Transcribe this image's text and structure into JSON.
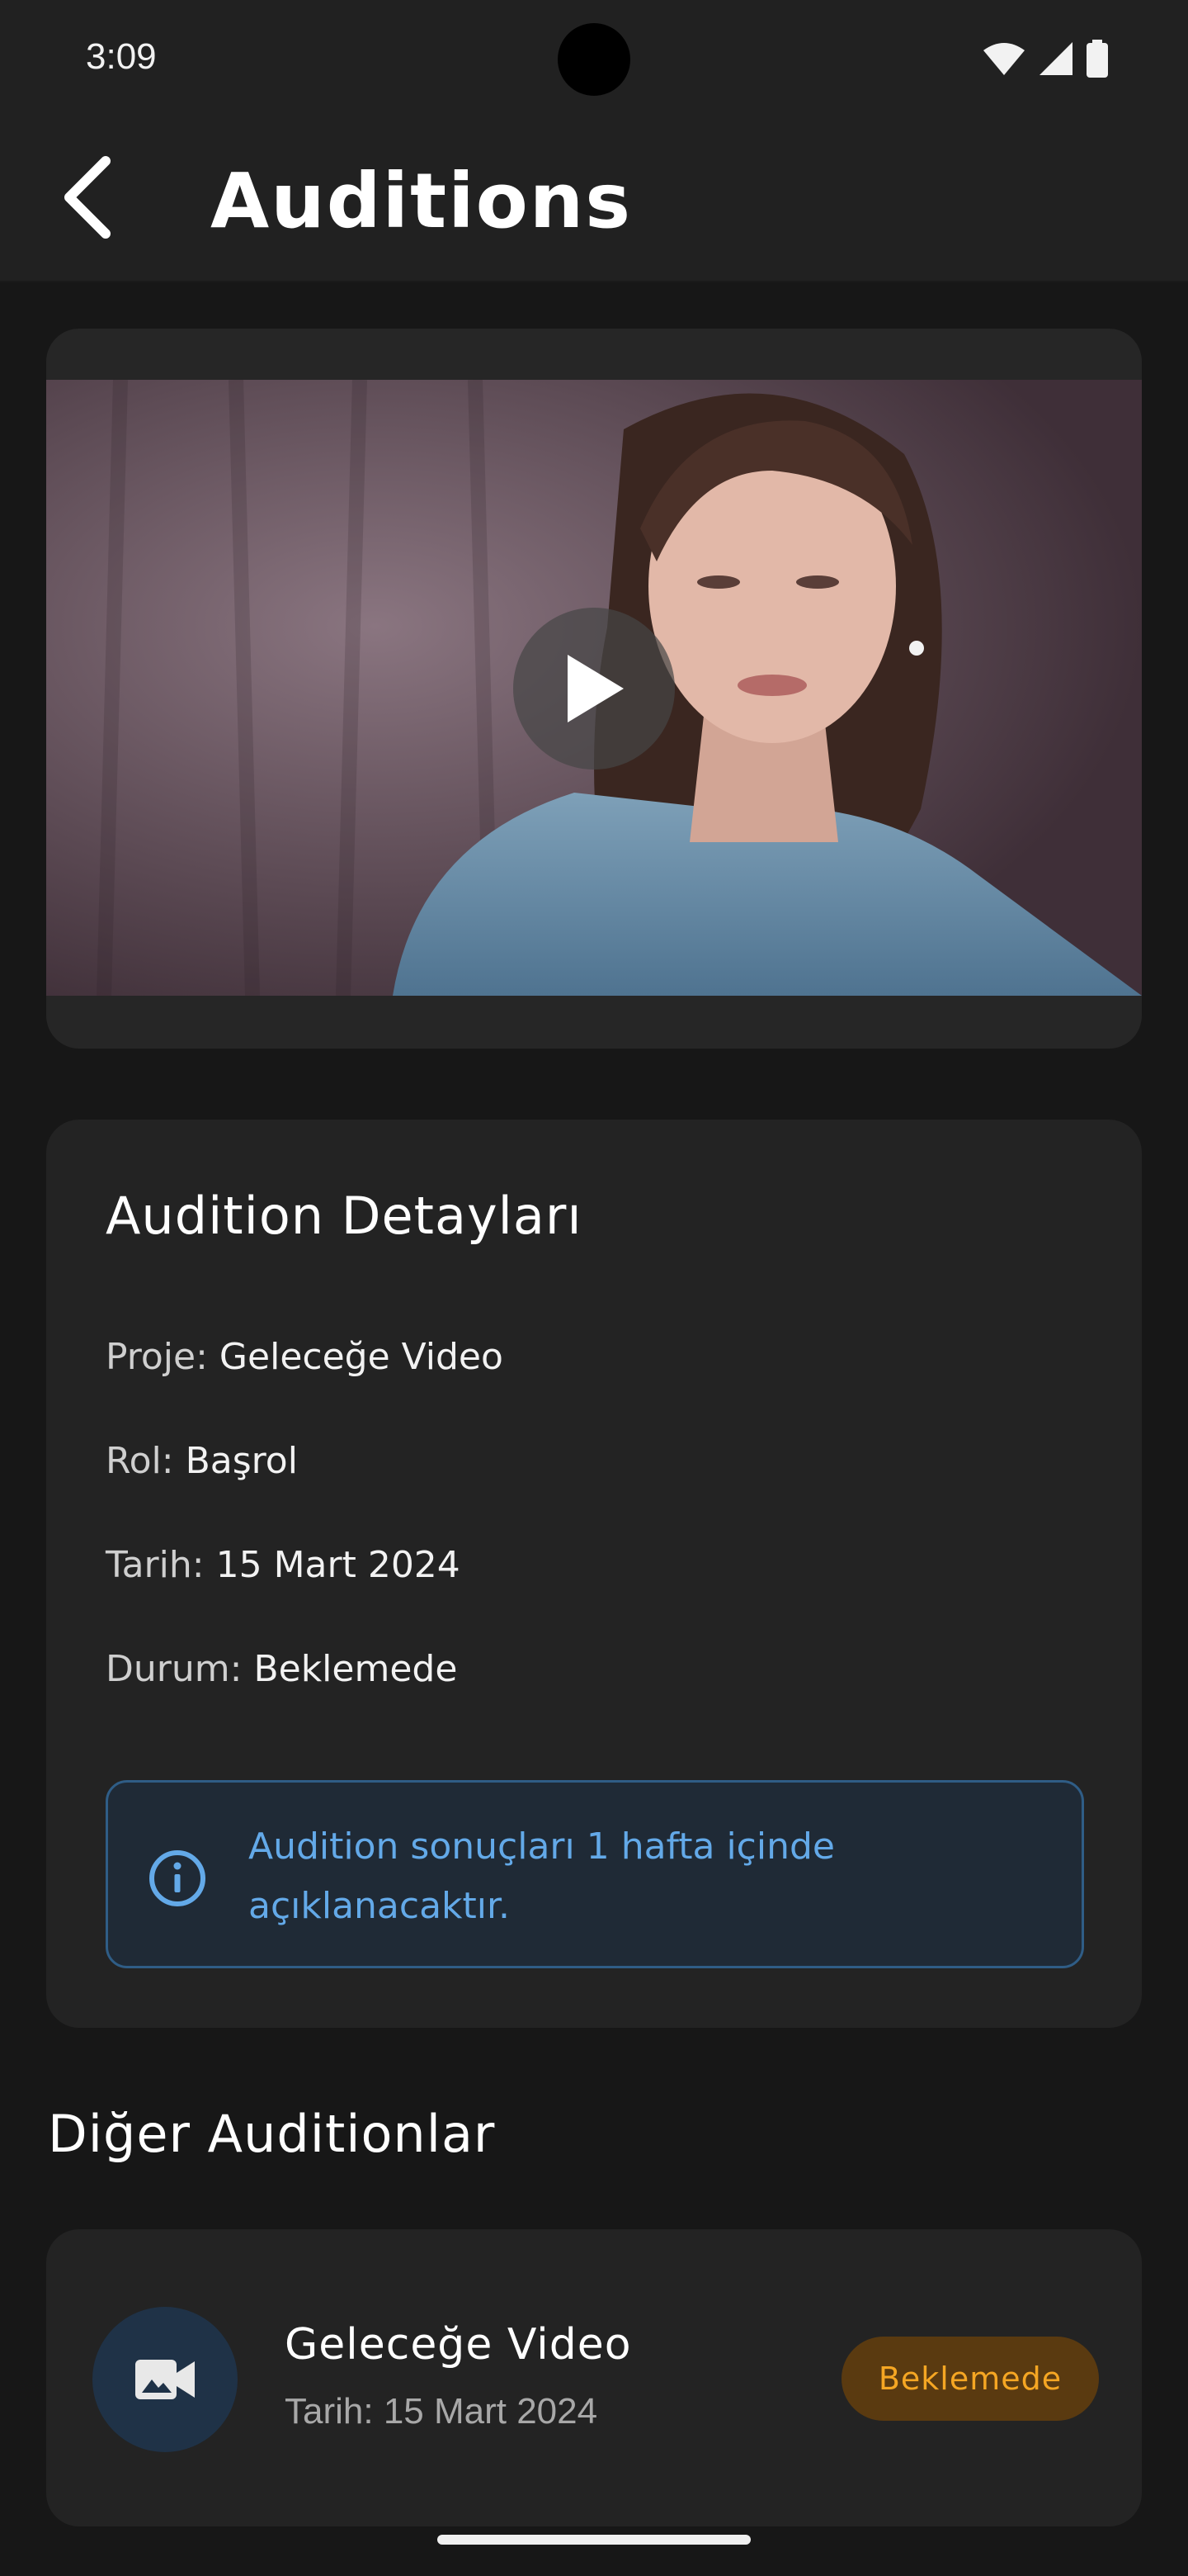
{
  "status_bar": {
    "time": "3:09"
  },
  "app_bar": {
    "title": "Auditions"
  },
  "video": {
    "play_label": "Play"
  },
  "details": {
    "title": "Audition Detayları",
    "rows": [
      {
        "key": "Proje:",
        "value": "Geleceğe Video"
      },
      {
        "key": "Rol:",
        "value": "Başrol"
      },
      {
        "key": "Tarih:",
        "value": "15 Mart 2024"
      },
      {
        "key": "Durum:",
        "value": "Beklemede"
      }
    ],
    "info": "Audition sonuçları 1 hafta içinde açıklanacaktır."
  },
  "other": {
    "title": "Diğer Auditionlar",
    "items": [
      {
        "title": "Geleceğe Video",
        "date": "Tarih: 15 Mart 2024",
        "status": "Beklemede"
      }
    ]
  },
  "colors": {
    "background": "#171717",
    "surface": "#232323",
    "info_accent": "#63a9e8",
    "pending_badge_text": "#f5a623",
    "pending_badge_bg": "#5a3a10"
  },
  "icons": [
    "wifi-icon",
    "signal-icon",
    "battery-icon",
    "back-arrow-icon",
    "play-icon",
    "info-icon",
    "video-camera-icon"
  ]
}
